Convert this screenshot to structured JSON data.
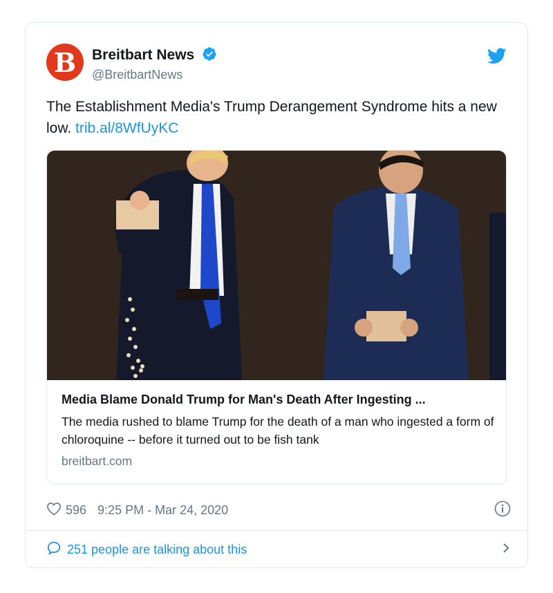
{
  "author": {
    "avatar_letter": "B",
    "name": "Breitbart News",
    "handle": "@BreitbartNews"
  },
  "tweet": {
    "text": "The Establishment Media's Trump Derangement Syndrome hits a new low.",
    "link": "trib.al/8WfUyKC"
  },
  "card": {
    "title": "Media Blame Donald Trump for Man's Death After Ingesting ...",
    "description": "The media rushed to blame Trump for the death of a man who ingested a form of chloroquine -- before it turned out to be fish tank",
    "domain": "breitbart.com"
  },
  "meta": {
    "likes": "596",
    "timestamp": "9:25 PM - Mar 24, 2020"
  },
  "footer": {
    "conversation": "251 people are talking about this"
  },
  "colors": {
    "brand_red": "#e2391d",
    "twitter_blue": "#1b95e0",
    "muted": "#657786"
  },
  "icons": [
    "verified-badge-icon",
    "twitter-bird-icon",
    "heart-icon",
    "info-icon",
    "speech-bubble-icon",
    "chevron-right-icon"
  ]
}
